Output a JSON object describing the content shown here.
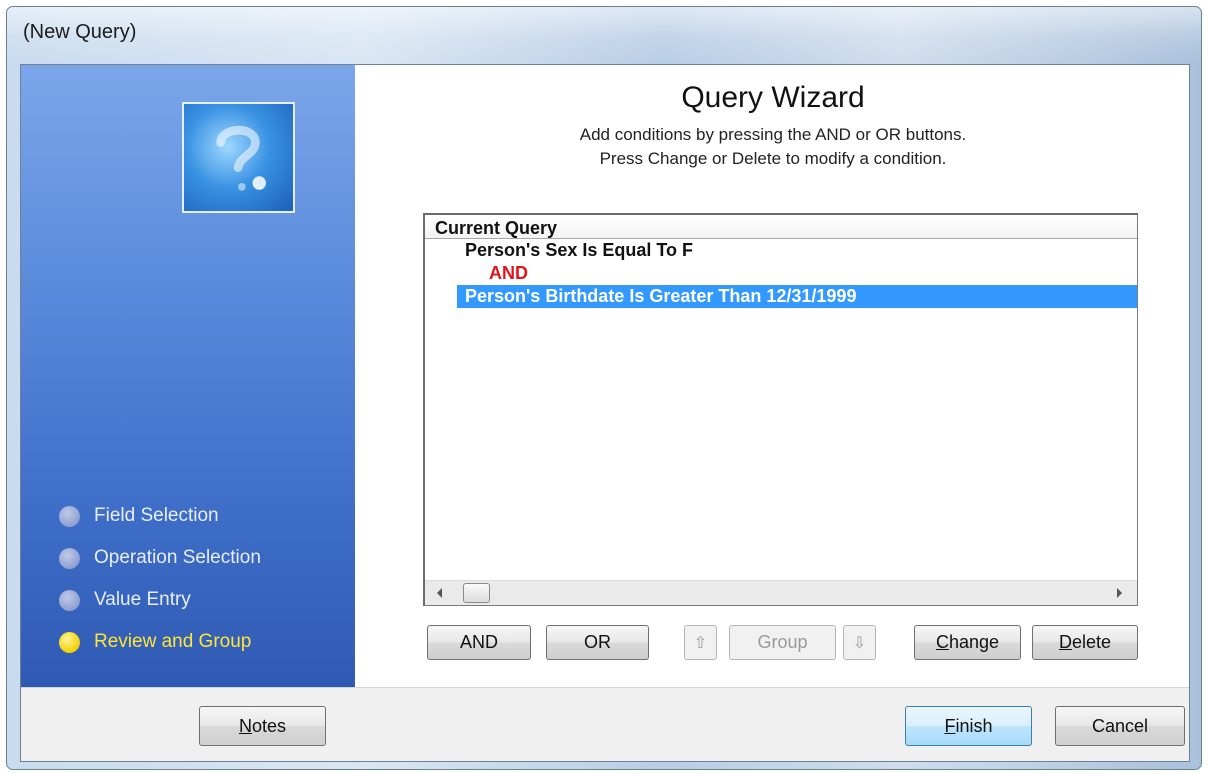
{
  "window": {
    "title": "(New Query)"
  },
  "sidebar": {
    "logo": "question-mark-icon",
    "steps": [
      {
        "label": "Field Selection",
        "active": false
      },
      {
        "label": "Operation Selection",
        "active": false
      },
      {
        "label": "Value Entry",
        "active": false
      },
      {
        "label": "Review and Group",
        "active": true
      }
    ]
  },
  "wizard": {
    "title": "Query Wizard",
    "description_line1": "Add conditions by pressing the AND or OR buttons.",
    "description_line2": "Press Change or Delete to modify a condition."
  },
  "query": {
    "header": "Current Query",
    "rows": [
      {
        "text": "Person's Sex Is Equal To F",
        "kind": "condition",
        "selected": false
      },
      {
        "text": "AND",
        "kind": "operator",
        "selected": false
      },
      {
        "text": "Person's Birthdate Is Greater Than 12/31/1999",
        "kind": "condition",
        "selected": true
      }
    ]
  },
  "toolbar": {
    "and_label": "AND",
    "or_label": "OR",
    "move_up_icon": "arrow-up-icon",
    "group_label": "Group",
    "move_down_icon": "arrow-down-icon",
    "change_label": "Change",
    "delete_label": "Delete"
  },
  "footer": {
    "notes_label": "Notes",
    "finish_label": "Finish",
    "cancel_label": "Cancel"
  },
  "colors": {
    "sidebar_top": "#7ba6ea",
    "sidebar_bottom": "#2f5ab3",
    "operator_red": "#e2141b",
    "selection_blue": "#3399ff",
    "active_step_yellow": "#ffe43a"
  }
}
